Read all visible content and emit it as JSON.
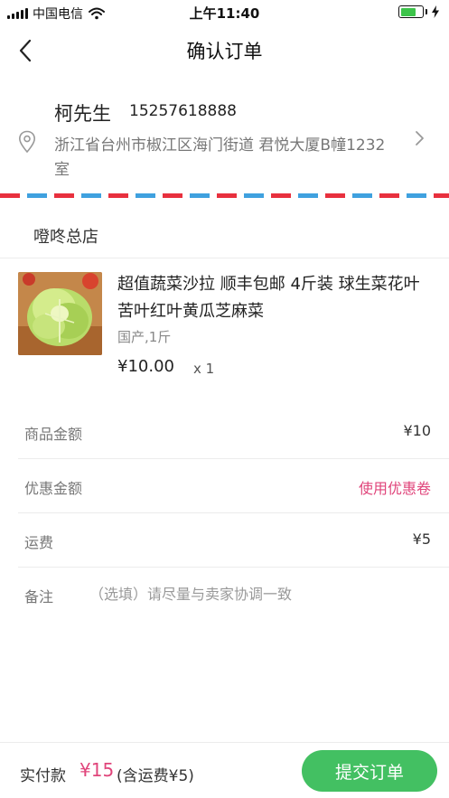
{
  "status_bar": {
    "carrier": "中国电信",
    "time": "上午11:40"
  },
  "nav": {
    "title": "确认订单"
  },
  "address": {
    "name": "柯先生",
    "phone": "15257618888",
    "detail": "浙江省台州市椒江区海门街道 君悦大厦B幢1232室"
  },
  "shop": {
    "name": "噔咚总店"
  },
  "product": {
    "title": "超值蔬菜沙拉 顺丰包邮 4斤装 球生菜花叶苦叶红叶黄瓜芝麻菜",
    "spec": "国产,1斤",
    "price": "¥10.00",
    "quantity": "x 1"
  },
  "summary": {
    "goods_label": "商品金额",
    "goods_value": "¥10",
    "discount_label": "优惠金额",
    "discount_action": "使用优惠卷",
    "shipping_label": "运费",
    "shipping_value": "¥5",
    "remark_label": "备注",
    "remark_placeholder": "（选填）请尽量与卖家协调一致"
  },
  "footer": {
    "pay_label": "实付款",
    "pay_amount": "¥15",
    "pay_freight": "(含运费¥5)",
    "submit_label": "提交订单"
  },
  "colors": {
    "accent_pink": "#e0457b",
    "submit_green": "#43c062",
    "stripe_red": "#e8303e",
    "stripe_blue": "#3fa1df"
  },
  "icons": [
    "signal-icon",
    "wifi-icon",
    "battery-icon",
    "charging-icon",
    "back-arrow-icon",
    "location-pin-icon",
    "chevron-right-icon"
  ]
}
